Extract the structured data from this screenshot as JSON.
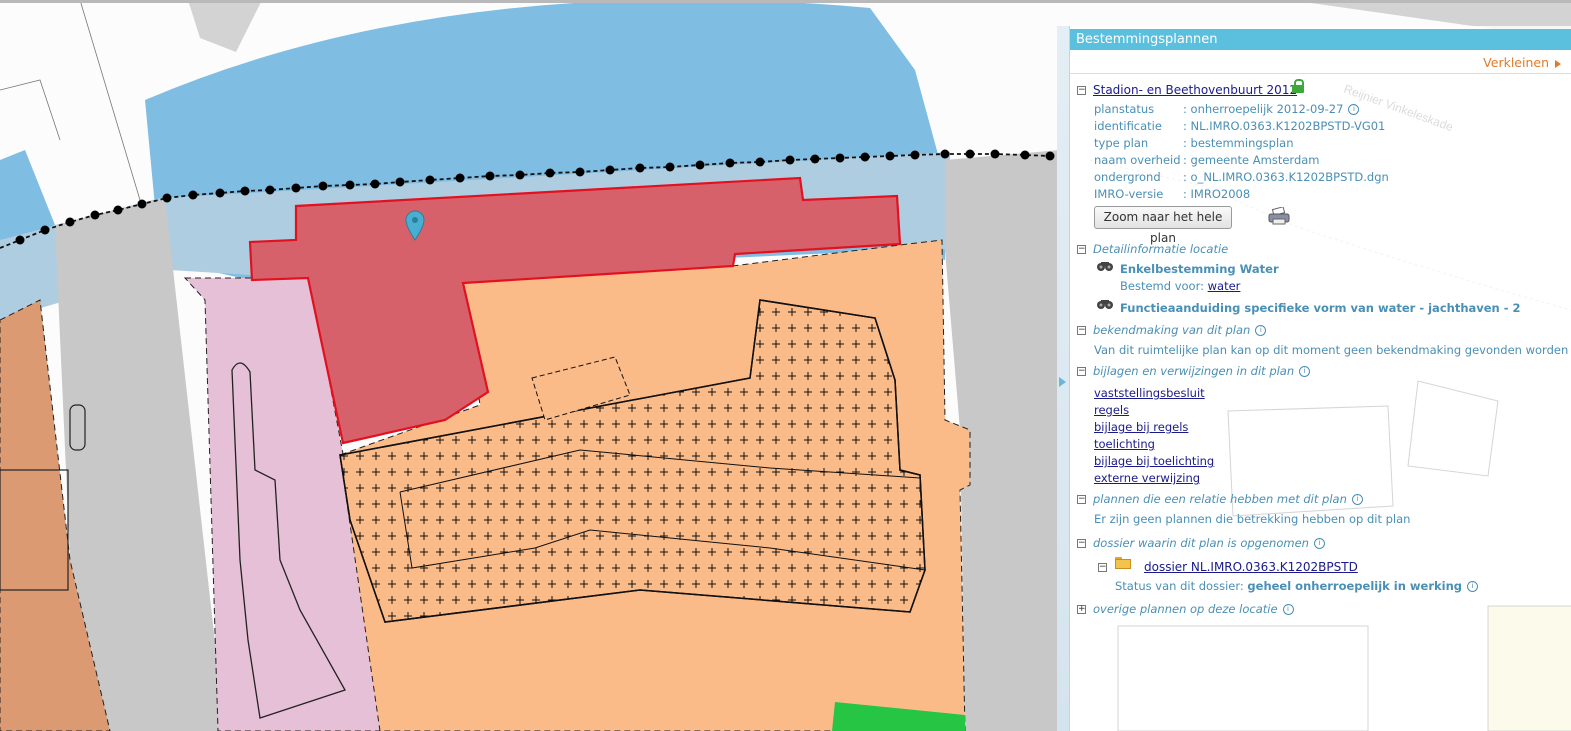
{
  "panel": {
    "title": "Bestemmingsplannen",
    "collapse_label": "Verkleinen",
    "plan": {
      "name": "Stadion- en Beethovenbuurt 2012",
      "fields": [
        {
          "label": "planstatus",
          "value": ": onherroepelijk 2012-09-27"
        },
        {
          "label": "identificatie",
          "value": ": NL.IMRO.0363.K1202BPSTD-VG01"
        },
        {
          "label": "type plan",
          "value": ": bestemmingsplan"
        },
        {
          "label": "naam overheid",
          "value": ": gemeente Amsterdam"
        },
        {
          "label": "ondergrond",
          "value": ": o_NL.IMRO.0363.K1202BPSTD.dgn"
        },
        {
          "label": "IMRO-versie",
          "value": ": IMRO2008"
        }
      ],
      "zoom_button": "Zoom naar het hele plan"
    },
    "detail": {
      "heading": "Detailinformatie locatie",
      "enkelbestemming": "Enkelbestemming Water",
      "bestemd_voor_label": "Bestemd voor:",
      "bestemd_voor_value": "water",
      "functieaanduiding": "Functieaanduiding specifieke vorm van water - jachthaven - 2"
    },
    "bekendmaking": {
      "heading": "bekendmaking van dit plan",
      "text": "Van dit ruimtelijke plan kan op dit moment geen bekendmaking gevonden worden"
    },
    "bijlagen": {
      "heading": "bijlagen en verwijzingen in dit plan",
      "links": [
        "vaststellingsbesluit",
        "regels",
        "bijlage bij regels",
        "toelichting",
        "bijlage bij toelichting",
        "externe verwijzing"
      ]
    },
    "relaties": {
      "heading": "plannen die een relatie hebben met dit plan",
      "text": "Er zijn geen plannen die betrekking hebben op dit plan"
    },
    "dossier": {
      "heading": "dossier waarin dit plan is opgenomen",
      "name": "dossier NL.IMRO.0363.K1202BPSTD",
      "status_label": "Status van dit dossier:",
      "status_value": "geheel onherroepelijk in werking"
    },
    "overige": {
      "heading": "overige plannen op deze locatie"
    }
  },
  "map": {
    "street_label": "Reijnier Vinkeleskade",
    "colors": {
      "water": "#7fbde3",
      "water_light": "#aecde0",
      "road": "#c8c8c8",
      "orange": "#fbbb88",
      "brown": "#dc9a72",
      "pink": "#e6c0d6",
      "green": "#27c544",
      "selected": "#d7616b",
      "selected_outline": "#e3101f",
      "marker": "#4aaed0"
    }
  }
}
